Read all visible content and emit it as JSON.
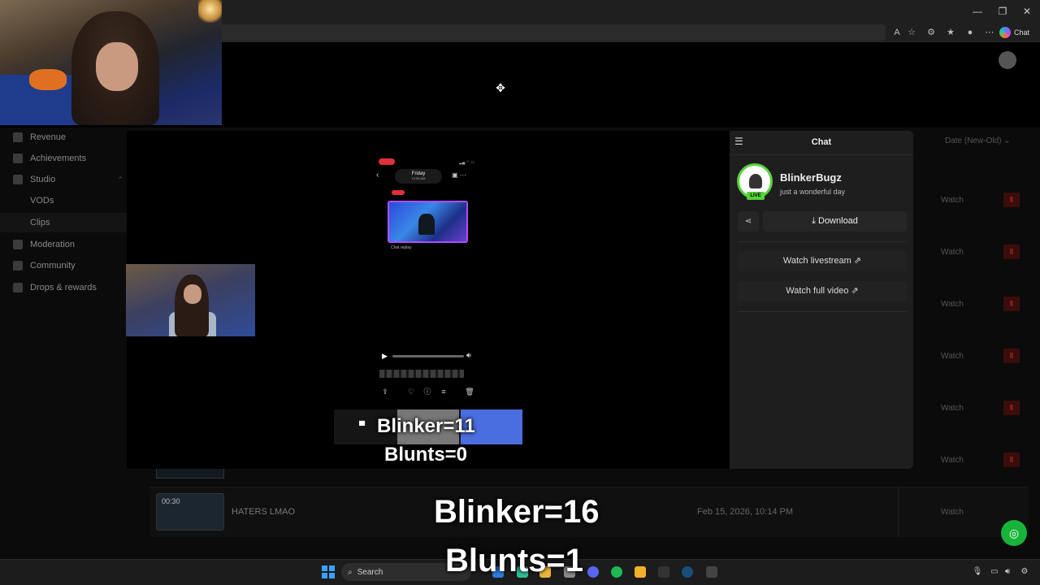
{
  "browser": {
    "copilot_label": "Chat",
    "window_controls": {
      "minimize": "—",
      "maximize": "❐",
      "close": "✕"
    }
  },
  "sidebar": {
    "items": [
      {
        "label": "Revenue",
        "icon": "bar-chart-icon"
      },
      {
        "label": "Achievements",
        "icon": "trophy-icon"
      },
      {
        "label": "Studio",
        "icon": "studio-icon"
      },
      {
        "label": "VODs",
        "icon": ""
      },
      {
        "label": "Clips",
        "icon": ""
      },
      {
        "label": "Moderation",
        "icon": "wrench-icon"
      },
      {
        "label": "Community",
        "icon": "people-icon"
      },
      {
        "label": "Drops & rewards",
        "icon": "gift-icon"
      }
    ],
    "active": "Clips"
  },
  "clips_list": {
    "sort_label": "Date (New-Old)",
    "watch_label": "Watch",
    "last_row": {
      "duration": "00:30",
      "title": "HATERS LMAO",
      "date": "Feb 15, 2026, 10:14 PM"
    }
  },
  "chat_panel": {
    "title": "Chat",
    "streamer_name": "BlinkerBugz",
    "streamer_status": "just a wonderful day",
    "live_badge": "LIVE",
    "download_label": "Download",
    "watch_livestream_label": "Watch livestream",
    "watch_full_video_label": "Watch full video"
  },
  "phone_screen": {
    "day": "Friday",
    "time": "10:55 AM",
    "chat_replay_label": "Chat replay"
  },
  "overlay": {
    "small_blinker": "Blinker=11",
    "small_blunts": "Blunts=0",
    "big_blinker": "Blinker=16",
    "big_blunts": "Blunts=1"
  },
  "taskbar": {
    "search_label": "Search"
  },
  "colors": {
    "accent_green": "#54d23a",
    "trash_red": "#3a0c0c",
    "help_green": "#18b43a"
  }
}
